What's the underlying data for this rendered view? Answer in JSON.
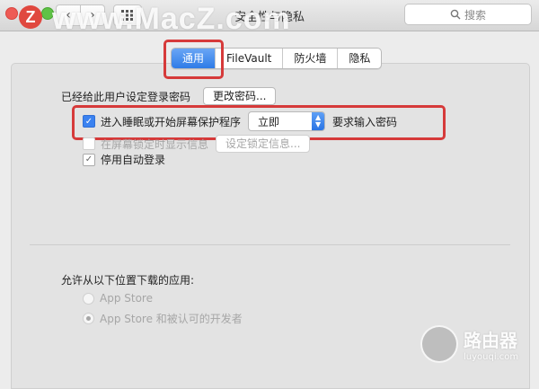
{
  "window": {
    "title": "安全性与隐私"
  },
  "toolbar": {
    "back_glyph": "‹",
    "forward_glyph": "›",
    "grid_icon": "grid-icon",
    "search_placeholder": "搜索"
  },
  "watermark": {
    "text": "www.MacZ.com",
    "logo_letter": "Z",
    "corner_title": "路由器",
    "corner_url": "luyouqi.com"
  },
  "tabs": [
    {
      "label": "通用",
      "active": true
    },
    {
      "label": "FileVault",
      "active": false
    },
    {
      "label": "防火墙",
      "active": false
    },
    {
      "label": "隐私",
      "active": false
    }
  ],
  "general": {
    "password_set_label": "已经给此用户设定登录密码",
    "change_password_button": "更改密码...",
    "require_password": {
      "checked": true,
      "label": "进入睡眠或开始屏幕保护程序",
      "select_value": "立即",
      "suffix": "要求输入密码"
    },
    "lock_message": {
      "checked": false,
      "label": "在屏幕锁定时显示信息",
      "button": "设定锁定信息..."
    },
    "auto_login": {
      "checked": true,
      "label": "停用自动登录"
    }
  },
  "downloads": {
    "heading": "允许从以下位置下载的应用:",
    "options": [
      {
        "label": "App Store",
        "selected": false
      },
      {
        "label": "App Store 和被认可的开发者",
        "selected": true
      }
    ]
  },
  "colors": {
    "accent": "#2e7be7",
    "highlight": "#d63a3a"
  }
}
